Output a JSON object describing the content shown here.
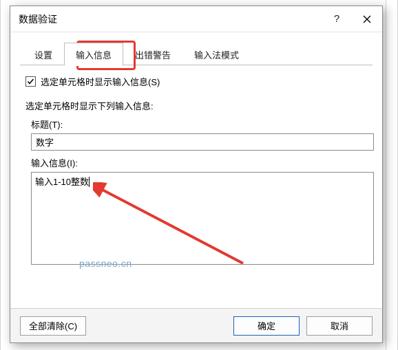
{
  "dialog": {
    "title": "数据验证",
    "help_icon": "?",
    "tabs": {
      "settings": "设置",
      "input_message": "输入信息",
      "error_alert": "出错警告",
      "ime_mode": "输入法模式",
      "active_index": 1
    },
    "checkbox": {
      "label": "选定单元格时显示输入信息(S)",
      "checked": true
    },
    "section_label": "选定单元格时显示下列输入信息:",
    "title_field": {
      "label": "标题(T):",
      "value": "数字"
    },
    "message_field": {
      "label": "输入信息(I):",
      "value": "输入1-10整数"
    },
    "buttons": {
      "clear_all": "全部清除(C)",
      "ok": "确定",
      "cancel": "取消"
    }
  },
  "watermark": "passneo.cn",
  "annotation": {
    "highlight_tab": "input_message",
    "arrow_target": "message_field"
  }
}
